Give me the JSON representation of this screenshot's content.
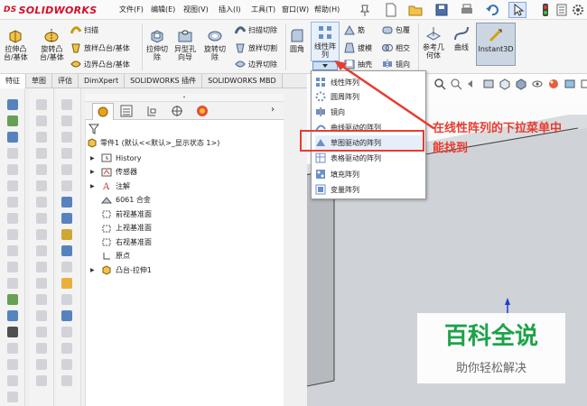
{
  "app": {
    "logo_brand": "SOLIDWORKS",
    "logo_ds": "DS"
  },
  "menubar": {
    "items": [
      "文件(F)",
      "编辑(E)",
      "视图(V)",
      "插入(I)",
      "工具(T)",
      "窗口(W)",
      "帮助(H)"
    ]
  },
  "ribbon": {
    "extrude_boss": "拉伸凸\n台/基体",
    "revolve_boss": "旋转凸\n台/基体",
    "sweep": "扫描",
    "loft_boss": "放样凸台/基体",
    "boundary_boss": "边界凸台/基体",
    "extrude_cut": "拉伸切\n除",
    "hole_wizard": "异型孔\n向导",
    "revolve_cut": "旋转切\n除",
    "sweep_cut": "扫描切除",
    "loft_cut": "放样切割",
    "boundary_cut": "边界切除",
    "fillet": "圆角",
    "linear_pattern": "线性阵\n列",
    "rib": "筋",
    "draft": "拔模",
    "shell": "抽壳",
    "wrap": "包覆",
    "intersect": "相交",
    "mirror": "镜向",
    "ref_geometry": "参考几\n何体",
    "curves": "曲线",
    "instant3d": "Instant3D"
  },
  "tabs": [
    "特征",
    "草图",
    "评估",
    "DimXpert",
    "SOLIDWORKS 插件",
    "SOLIDWORKS MBD"
  ],
  "dropdown": {
    "items": [
      "线性阵列",
      "圆周阵列",
      "镜向",
      "曲线驱动的阵列",
      "草图驱动的阵列",
      "表格驱动的阵列",
      "填充阵列",
      "变量阵列"
    ],
    "highlighted_index": 4
  },
  "annotation": {
    "line1": "在线性阵列的下拉菜单中",
    "line2": "能找到"
  },
  "feature_tree": {
    "root": "零件1  (默认<<默认>_显示状态 1>)",
    "items": [
      "History",
      "传感器",
      "注解",
      "6061 合金",
      "前视基准面",
      "上视基准面",
      "右视基准面",
      "原点",
      "凸台-拉伸1"
    ]
  },
  "watermark": {
    "title": "百科全说",
    "subtitle": "助你轻松解决"
  },
  "colors": {
    "accent_red": "#e83b2f",
    "brand_red": "#d0102b",
    "watermark_green": "#1ea24a"
  }
}
